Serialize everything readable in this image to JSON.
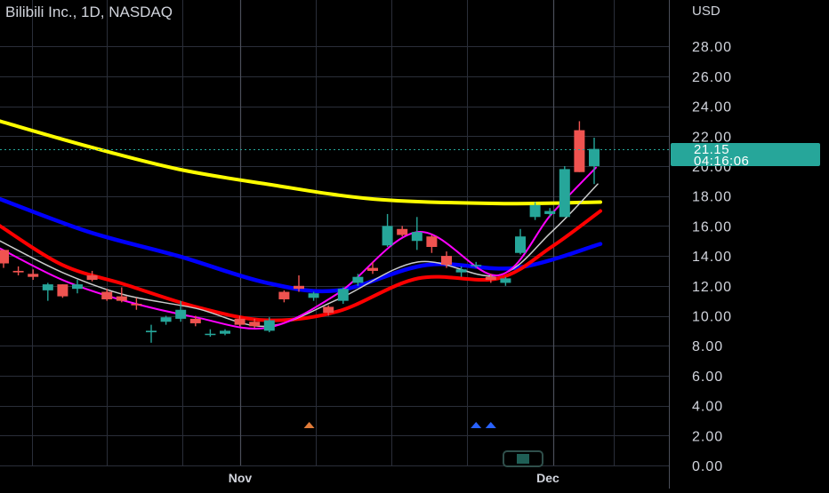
{
  "header": {
    "symbol_title": "Bilibili Inc., 1D, NASDAQ",
    "currency": "USD"
  },
  "price_tag": {
    "price": "21.15",
    "countdown": "04:16:06",
    "color": "#26a69a"
  },
  "colors": {
    "background": "#000000",
    "grid": "#2a2e39",
    "separator": "#4a4e59",
    "up_candle": "#26a69a",
    "down_candle": "#ef5350",
    "ma_yellow": "#ffff00",
    "ma_blue": "#0000ff",
    "ma_red": "#ff0000",
    "ma_white": "#cccccc",
    "ma_magenta": "#ff00ff",
    "marker_orange": "#e07b39",
    "marker_blue": "#2962ff"
  },
  "chart_data": {
    "type": "candlestick",
    "title": "Bilibili Inc., 1D, NASDAQ",
    "ylabel": "USD",
    "ylim": [
      0,
      30
    ],
    "y_ticks": [
      "0.00",
      "2.00",
      "4.00",
      "6.00",
      "8.00",
      "10.00",
      "12.00",
      "14.00",
      "16.00",
      "18.00",
      "20.00",
      "22.00",
      "24.00",
      "26.00",
      "28.00"
    ],
    "x_ticks": [
      {
        "label": "Nov",
        "at": "Nov 1"
      },
      {
        "label": "Dec",
        "at": "Dec 1"
      }
    ],
    "grid": true,
    "candles": [
      {
        "date": "Oct 3",
        "open": 14.4,
        "high": 14.4,
        "low": 13.2,
        "close": 13.5
      },
      {
        "date": "Oct 4",
        "open": 13.0,
        "high": 13.3,
        "low": 12.7,
        "close": 12.9
      },
      {
        "date": "Oct 5",
        "open": 12.8,
        "high": 13.1,
        "low": 12.4,
        "close": 12.6
      },
      {
        "date": "Oct 6",
        "open": 11.7,
        "high": 12.2,
        "low": 11.0,
        "close": 12.1
      },
      {
        "date": "Oct 7",
        "open": 12.1,
        "high": 12.1,
        "low": 11.2,
        "close": 11.3
      },
      {
        "date": "Oct 10",
        "open": 11.8,
        "high": 12.4,
        "low": 11.5,
        "close": 12.1
      },
      {
        "date": "Oct 11",
        "open": 12.7,
        "high": 13.0,
        "low": 12.3,
        "close": 12.4
      },
      {
        "date": "Oct 12",
        "open": 11.6,
        "high": 11.8,
        "low": 11.0,
        "close": 11.1
      },
      {
        "date": "Oct 13",
        "open": 11.3,
        "high": 11.9,
        "low": 10.9,
        "close": 11.0
      },
      {
        "date": "Oct 14",
        "open": 10.8,
        "high": 11.2,
        "low": 10.4,
        "close": 10.7
      },
      {
        "date": "Oct 17",
        "open": 8.9,
        "high": 9.4,
        "low": 8.2,
        "close": 9.0
      },
      {
        "date": "Oct 18",
        "open": 9.6,
        "high": 10.0,
        "low": 9.4,
        "close": 9.9
      },
      {
        "date": "Oct 19",
        "open": 9.8,
        "high": 11.0,
        "low": 9.6,
        "close": 10.4
      },
      {
        "date": "Oct 20",
        "open": 9.8,
        "high": 10.0,
        "low": 9.3,
        "close": 9.5
      },
      {
        "date": "Oct 21",
        "open": 8.8,
        "high": 9.1,
        "low": 8.6,
        "close": 8.8
      },
      {
        "date": "Oct 24",
        "open": 8.8,
        "high": 9.1,
        "low": 8.7,
        "close": 9.0
      },
      {
        "date": "Oct 25",
        "open": 9.8,
        "high": 10.0,
        "low": 9.3,
        "close": 9.4
      },
      {
        "date": "Oct 26",
        "open": 9.6,
        "high": 9.8,
        "low": 9.2,
        "close": 9.3
      },
      {
        "date": "Oct 27",
        "open": 9.0,
        "high": 9.9,
        "low": 8.9,
        "close": 9.7
      },
      {
        "date": "Oct 28",
        "open": 11.6,
        "high": 11.7,
        "low": 10.9,
        "close": 11.1
      },
      {
        "date": "Oct 31",
        "open": 12.0,
        "high": 12.7,
        "low": 11.6,
        "close": 11.8
      },
      {
        "date": "Nov 1",
        "open": 11.2,
        "high": 11.6,
        "low": 11.0,
        "close": 11.5
      },
      {
        "date": "Nov 2",
        "open": 10.6,
        "high": 10.7,
        "low": 10.0,
        "close": 10.2
      },
      {
        "date": "Nov 3",
        "open": 11.0,
        "high": 11.9,
        "low": 10.8,
        "close": 11.8
      },
      {
        "date": "Nov 4",
        "open": 12.2,
        "high": 12.8,
        "low": 12.0,
        "close": 12.6
      },
      {
        "date": "Nov 7",
        "open": 13.2,
        "high": 13.6,
        "low": 12.8,
        "close": 13.0
      },
      {
        "date": "Nov 8",
        "open": 14.7,
        "high": 16.8,
        "low": 14.6,
        "close": 16.0
      },
      {
        "date": "Nov 9",
        "open": 15.8,
        "high": 16.0,
        "low": 15.3,
        "close": 15.4
      },
      {
        "date": "Nov 10",
        "open": 15.0,
        "high": 16.6,
        "low": 14.4,
        "close": 15.6
      },
      {
        "date": "Nov 11",
        "open": 15.3,
        "high": 15.4,
        "low": 14.2,
        "close": 14.6
      },
      {
        "date": "Nov 14",
        "open": 14.0,
        "high": 14.3,
        "low": 13.2,
        "close": 13.4
      },
      {
        "date": "Nov 15",
        "open": 12.9,
        "high": 13.3,
        "low": 12.6,
        "close": 13.1
      },
      {
        "date": "Nov 16",
        "open": 13.4,
        "high": 13.6,
        "low": 13.2,
        "close": 13.4
      },
      {
        "date": "Nov 17",
        "open": 12.6,
        "high": 12.8,
        "low": 12.2,
        "close": 12.4
      },
      {
        "date": "Nov 18",
        "open": 12.2,
        "high": 12.6,
        "low": 12.0,
        "close": 12.5
      },
      {
        "date": "Nov 21",
        "open": 14.2,
        "high": 15.8,
        "low": 14.1,
        "close": 15.3
      },
      {
        "date": "Nov 22",
        "open": 16.6,
        "high": 17.6,
        "low": 16.4,
        "close": 17.4
      },
      {
        "date": "Nov 23",
        "open": 16.8,
        "high": 17.2,
        "low": 16.6,
        "close": 17.0
      },
      {
        "date": "Nov 25",
        "open": 16.6,
        "high": 20.0,
        "low": 16.6,
        "close": 19.8
      },
      {
        "date": "Nov 28",
        "open": 22.4,
        "high": 23.0,
        "low": 19.6,
        "close": 19.6
      },
      {
        "date": "Nov 29",
        "open": 20.0,
        "high": 21.9,
        "low": 18.8,
        "close": 21.15
      }
    ],
    "moving_averages": [
      {
        "color": "#ffff00",
        "values": [
          23.0,
          21.3,
          19.8,
          18.8,
          17.8,
          17.5,
          17.6
        ]
      },
      {
        "color": "#0000ff",
        "values": [
          17.8,
          15.6,
          14.0,
          12.2,
          11.7,
          13.4,
          13.2,
          14.8
        ]
      },
      {
        "color": "#ff0000",
        "values": [
          16.0,
          13.4,
          12.1,
          10.6,
          9.7,
          10.3,
          12.5,
          12.5,
          14.6,
          17.0
        ]
      },
      {
        "color": "#cccccc",
        "values": [
          15.0,
          12.9,
          11.4,
          10.5,
          9.3,
          11.1,
          13.6,
          12.7,
          15.6,
          18.8
        ]
      },
      {
        "color": "#ff00ff",
        "values": [
          14.5,
          12.4,
          11.0,
          9.9,
          9.2,
          11.5,
          15.6,
          12.7,
          16.8,
          19.9
        ]
      }
    ],
    "markers": [
      {
        "date": "Nov 1",
        "color": "#e07b39",
        "direction": "up"
      },
      {
        "date": "Nov 16",
        "color": "#2962ff",
        "direction": "up"
      },
      {
        "date": "Nov 17",
        "color": "#2962ff",
        "direction": "up"
      }
    ]
  }
}
